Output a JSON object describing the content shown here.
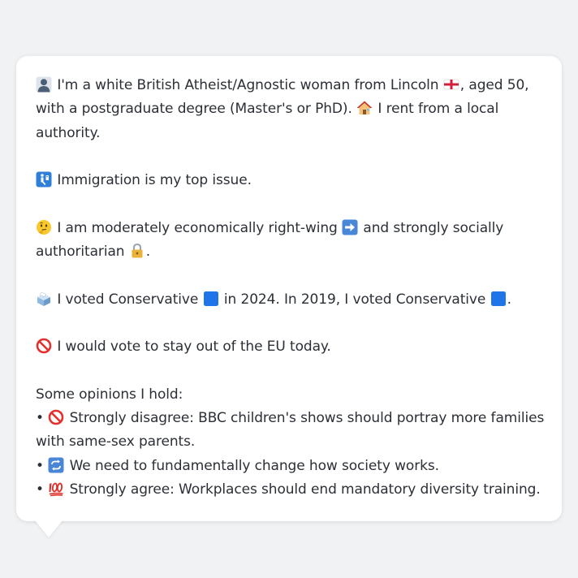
{
  "message": {
    "p1_l1_a": "I'm a white British Atheist/Agnostic woman from Lincoln",
    "p1_l1_b": ", aged 50,",
    "p1_l2_a": "with a postgraduate degree (Master's or PhD).",
    "p1_l2_b": "I rent from a local",
    "p1_l3": "authority.",
    "p2": "Immigration is my top issue.",
    "p3_l1_a": "I am moderately economically right-wing",
    "p3_l1_b": "and strongly socially",
    "p3_l2_a": "authoritarian",
    "p3_l2_b": ".",
    "p4_a": "I voted Conservative",
    "p4_b": "in 2024. In 2019, I voted Conservative",
    "p4_c": ".",
    "p5": "I would vote to stay out of the EU today.",
    "opinions_heading": "Some opinions I hold:",
    "bullet": "•",
    "op1_l1": "Strongly disagree: BBC children's shows should portray more families",
    "op1_l2": "with same-sex parents.",
    "op2": "We need to fundamentally change how society works.",
    "op3": "Strongly agree: Workplaces should end mandatory diversity training."
  },
  "icons": [
    "person-icon",
    "england-flag-icon",
    "house-icon",
    "passport-control-icon",
    "thinking-face-icon",
    "right-arrow-icon",
    "lock-icon",
    "ballot-box-icon",
    "blue-square-icon",
    "prohibited-icon",
    "repeat-icon",
    "hundred-points-icon"
  ],
  "colors": {
    "background": "#f1f2f4",
    "bubble": "#ffffff",
    "text": "#2b2f36",
    "conservative_blue": "#1e74e8"
  }
}
